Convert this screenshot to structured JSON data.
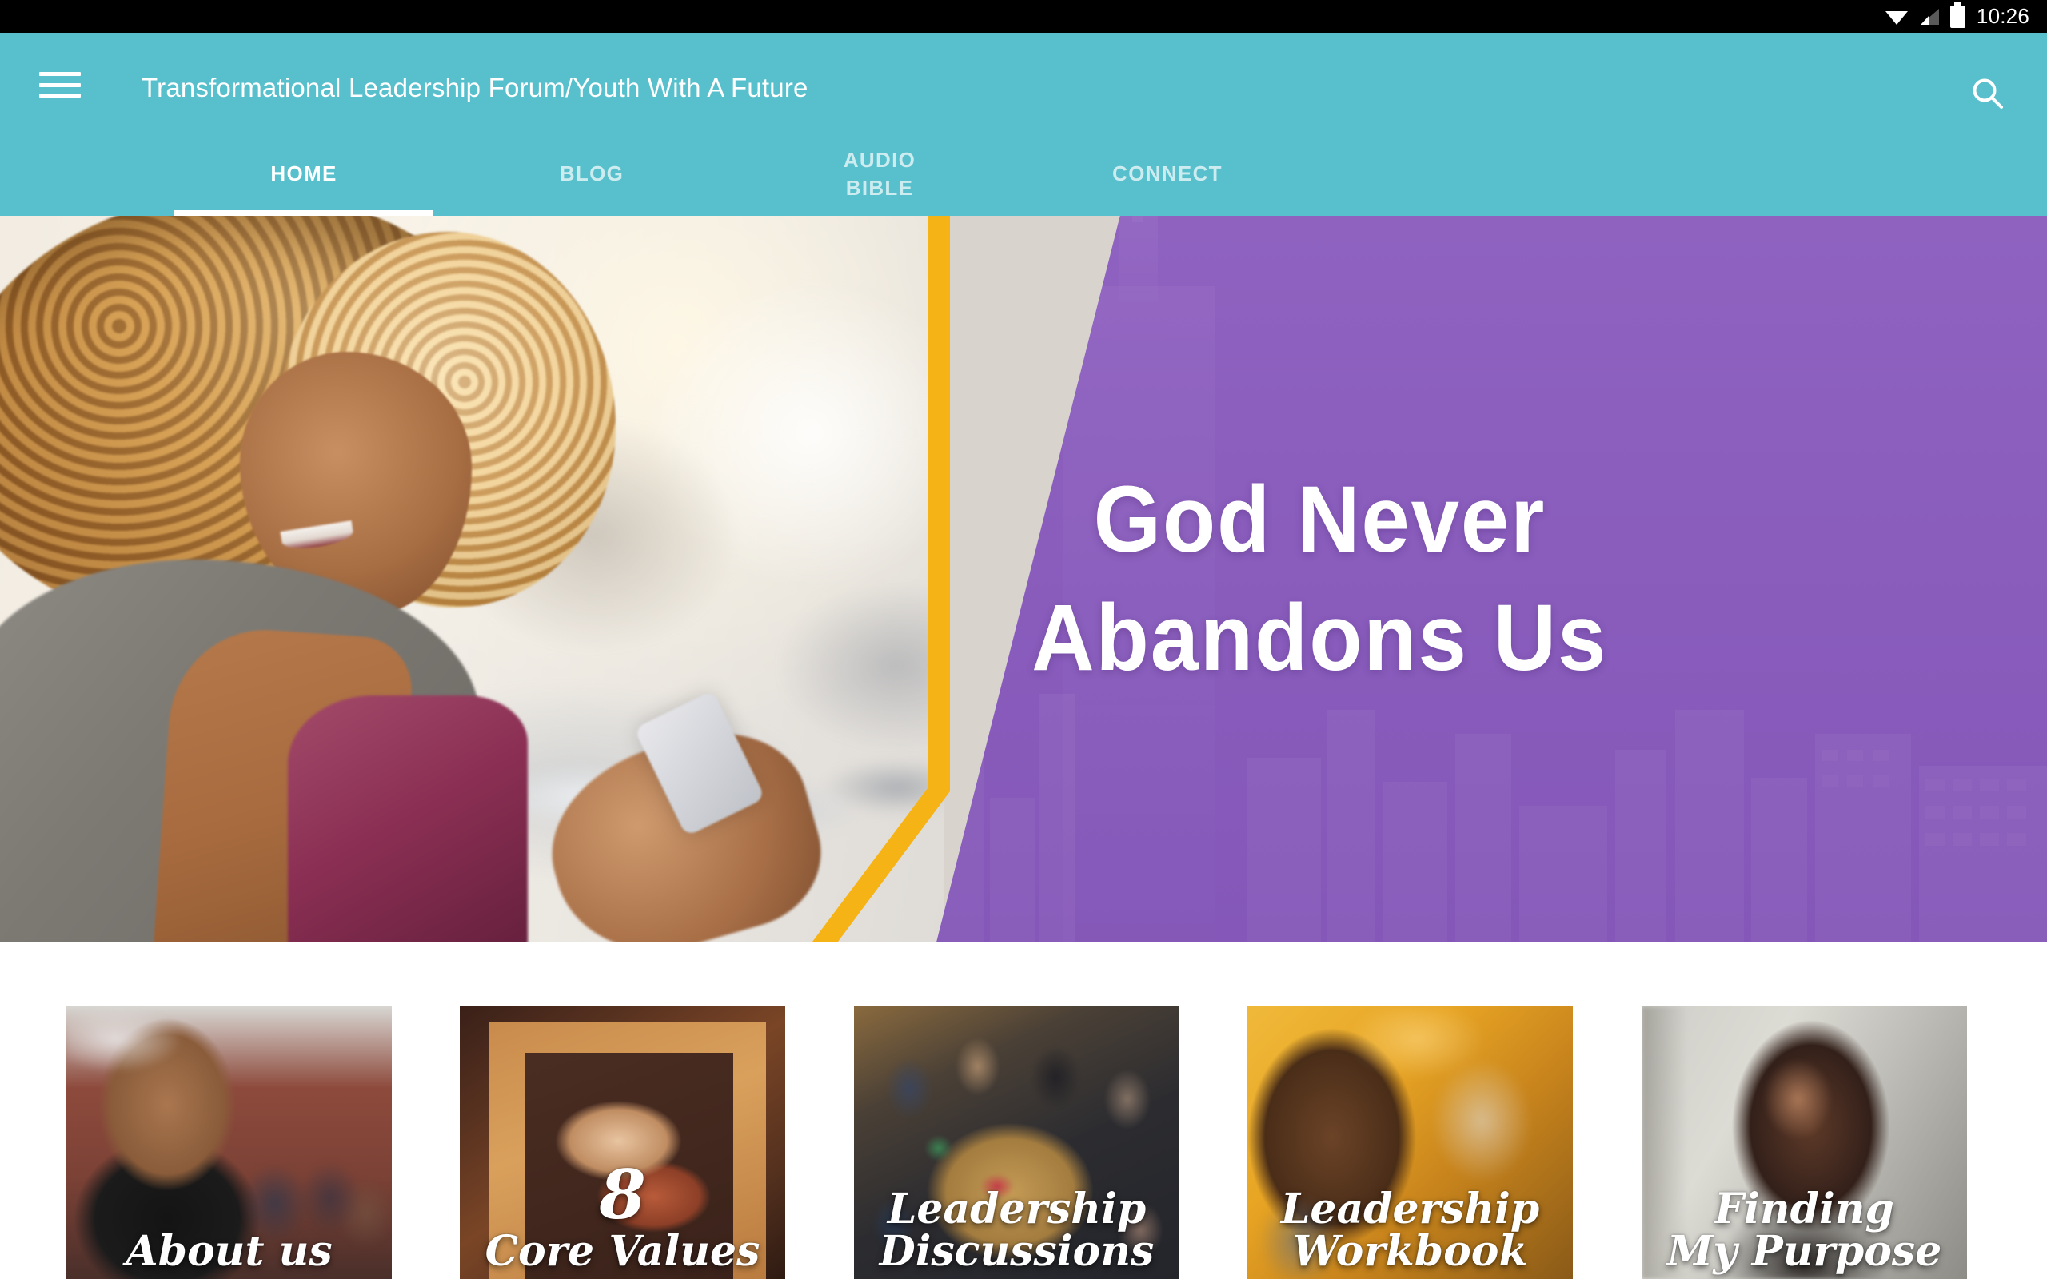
{
  "statusbar": {
    "time": "10:26",
    "icons": [
      "wifi-icon",
      "cell-signal-icon",
      "battery-icon"
    ]
  },
  "appbar": {
    "menu_icon": "hamburger-menu-icon",
    "title": "Transformational Leadership Forum/Youth With A Future",
    "search_icon": "search-icon",
    "background_color": "#57c0cc"
  },
  "tabs": [
    {
      "label": "HOME",
      "active": true
    },
    {
      "label": "BLOG",
      "active": false
    },
    {
      "label": "AUDIO\nBIBLE",
      "active": false
    },
    {
      "label": "CONNECT",
      "active": false
    }
  ],
  "hero": {
    "headline_line1": "God Never",
    "headline_line2": "Abandons Us",
    "accent_color": "#f5b316",
    "panel_color": "#8a5dbd",
    "left_image_alt": "smiling-woman-with-phone-photo",
    "right_image_alt": "purple-city-skyline-graphic"
  },
  "cards": [
    {
      "line1": "About us",
      "line2": "",
      "big": "",
      "image_alt": "man-in-sweater-photo"
    },
    {
      "line1": "Core Values",
      "line2": "",
      "big": "8",
      "image_alt": "framed-clasped-hands-photo"
    },
    {
      "line1": "Leadership",
      "line2": "Discussions",
      "big": "",
      "image_alt": "overhead-group-meeting-photo"
    },
    {
      "line1": "Leadership",
      "line2": "Workbook",
      "big": "",
      "image_alt": "woman-with-earbuds-photo"
    },
    {
      "line1": "Finding",
      "line2": "My Purpose",
      "big": "",
      "image_alt": "woman-looking-up-photo"
    }
  ]
}
